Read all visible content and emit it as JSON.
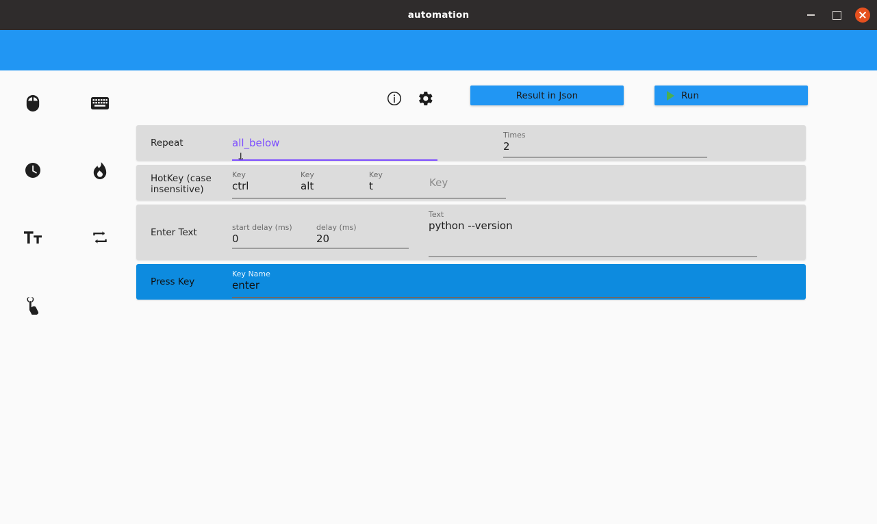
{
  "window": {
    "title": "automation",
    "controls": {
      "minimize": "minimize-button",
      "maximize": "maximize-button",
      "close": "close-button"
    },
    "accent_blue": "#2196f3",
    "titlebar_color": "#2f2c2c",
    "close_color": "#e6511f"
  },
  "sidebar": {
    "items": [
      {
        "icon": "mouse-icon",
        "name": "mouse"
      },
      {
        "icon": "keyboard-icon",
        "name": "keyboard"
      },
      {
        "icon": "clock-icon",
        "name": "wait"
      },
      {
        "icon": "fire-icon",
        "name": "hotkey"
      },
      {
        "icon": "text-format-icon",
        "name": "enter-text"
      },
      {
        "icon": "repeat-icon",
        "name": "repeat"
      },
      {
        "icon": "touch-icon",
        "name": "press-key"
      }
    ]
  },
  "toolbar": {
    "info_icon": "info-icon",
    "settings_icon": "gear-icon",
    "result_json_label": "Result in Json",
    "run_label": "Run",
    "run_icon": "play-icon",
    "run_icon_color": "#4caf50"
  },
  "rows": [
    {
      "id": "repeat",
      "label": "Repeat",
      "selected": false,
      "fields": [
        {
          "name": "repeat-mode-dropdown",
          "label": "",
          "value": "all_below",
          "accent": "#7c4dff",
          "has_dropdown": true,
          "arrow_glyph": "↓"
        },
        {
          "name": "times-input",
          "label": "Times",
          "value": "2"
        }
      ]
    },
    {
      "id": "hotkey",
      "label": "HotKey (case insensitive)",
      "selected": false,
      "fields": [
        {
          "name": "hotkey-key-1",
          "label": "Key",
          "value": "ctrl"
        },
        {
          "name": "hotkey-key-2",
          "label": "Key",
          "value": "alt"
        },
        {
          "name": "hotkey-key-3",
          "label": "Key",
          "value": "t"
        },
        {
          "name": "hotkey-key-4",
          "label": "",
          "value": "",
          "placeholder": "Key"
        }
      ]
    },
    {
      "id": "entertext",
      "label": "Enter Text",
      "selected": false,
      "fields": [
        {
          "name": "start-delay-input",
          "label": "start delay (ms)",
          "value": "0"
        },
        {
          "name": "delay-input",
          "label": "delay (ms)",
          "value": "20"
        },
        {
          "name": "text-input",
          "label": "Text",
          "value": "python --version"
        }
      ]
    },
    {
      "id": "presskey",
      "label": "Press Key",
      "selected": true,
      "fields": [
        {
          "name": "key-name-input",
          "label": "Key Name",
          "value": "enter"
        }
      ]
    }
  ]
}
